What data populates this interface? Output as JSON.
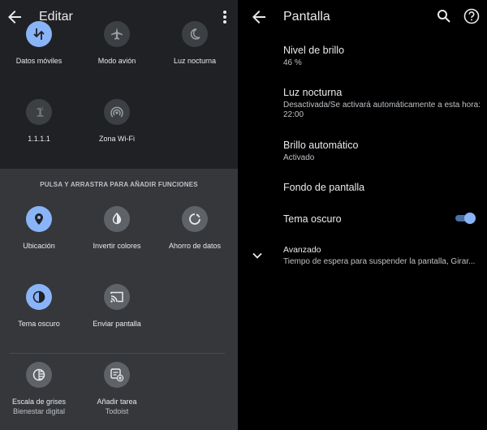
{
  "left": {
    "title": "Editar",
    "section_title": "PULSA Y ARRASTRA PARA AÑADIR FUNCIONES",
    "active_tiles": [
      {
        "label": "Datos móviles",
        "icon": "mobile-data-icon"
      },
      {
        "label": "Modo avión",
        "icon": "airplane-icon"
      },
      {
        "label": "Luz nocturna",
        "icon": "moon-icon"
      },
      {
        "label": "1.1.1.1",
        "icon": "one-one-one-one-icon"
      },
      {
        "label": "Zona Wi-Fi",
        "icon": "hotspot-icon"
      }
    ],
    "available_tiles": [
      {
        "label": "Ubicación",
        "icon": "location-icon"
      },
      {
        "label": "Invertir colores",
        "icon": "invert-colors-icon"
      },
      {
        "label": "Ahorro de datos",
        "icon": "data-saver-icon"
      },
      {
        "label": "Tema oscuro",
        "icon": "dark-theme-icon"
      },
      {
        "label": "Enviar pantalla",
        "icon": "cast-icon"
      },
      {
        "label": "Escala de grises",
        "sub": "Bienestar digital",
        "icon": "grayscale-icon"
      },
      {
        "label": "Añadir tarea",
        "sub": "Todoist",
        "icon": "add-task-icon"
      }
    ]
  },
  "right": {
    "title": "Pantalla",
    "items": [
      {
        "title": "Nivel de brillo",
        "summary": "46 %"
      },
      {
        "title": "Luz nocturna",
        "summary": "Desactivada/Se activará automáticamente a esta hora: 22:00"
      },
      {
        "title": "Brillo automático",
        "summary": "Activado"
      },
      {
        "title": "Fondo de pantalla"
      },
      {
        "title": "Tema oscuro",
        "toggle_on": true
      },
      {
        "title": "Avanzado",
        "summary": "Tiempo de espera para suspender la pantalla, Girar..."
      }
    ]
  },
  "colors": {
    "accent": "#8ab4f8",
    "panel_dark": "#202124",
    "panel_light": "#35373a",
    "text": "#e8eaed"
  }
}
